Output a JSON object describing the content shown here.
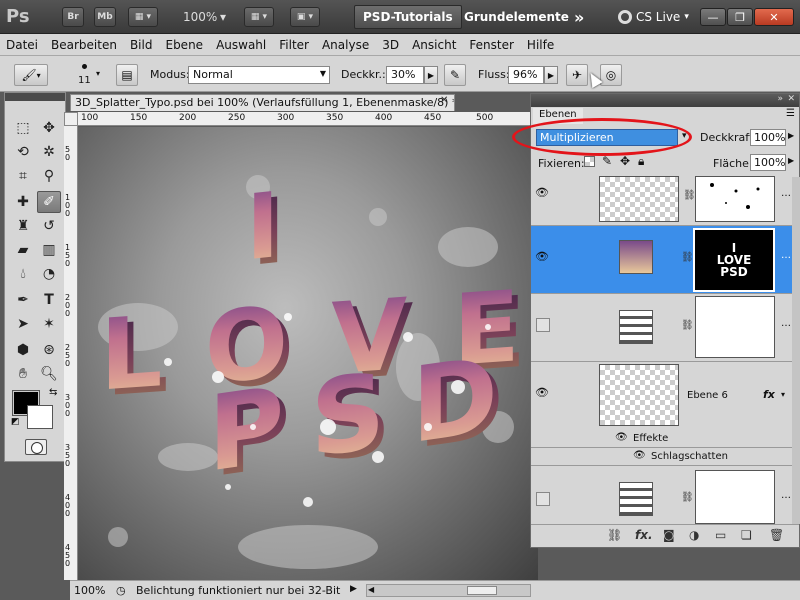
{
  "appbar": {
    "logo": "Ps",
    "btn_br": "Br",
    "btn_mb": "Mb",
    "zoom": "100%",
    "workspace_active": "PSD-Tutorials",
    "workspace_other": "Grundelemente",
    "more": "»",
    "cs_live": "CS Live",
    "win_min": "—",
    "win_restore": "❐",
    "win_close": "✕"
  },
  "menu": [
    "Datei",
    "Bearbeiten",
    "Bild",
    "Ebene",
    "Auswahl",
    "Filter",
    "Analyse",
    "3D",
    "Ansicht",
    "Fenster",
    "Hilfe"
  ],
  "options": {
    "brush_size": "11",
    "mode_label": "Modus:",
    "mode_value": "Normal",
    "opacity_label": "Deckkr.:",
    "opacity_value": "30%",
    "flow_label": "Fluss:",
    "flow_value": "96%"
  },
  "document": {
    "tab_title": "3D_Splatter_Typo.psd bei 100% (Verlaufsfüllung 1, Ebenenmaske/8) *",
    "close": "✕",
    "ruler_h": [
      "100",
      "150",
      "200",
      "250",
      "300",
      "350",
      "400",
      "450",
      "500"
    ],
    "ruler_v": [
      "5",
      "0",
      "1",
      "0",
      "0",
      "1",
      "5",
      "0",
      "2",
      "0",
      "0",
      "2",
      "5",
      "0",
      "3",
      "0",
      "0",
      "3",
      "5",
      "0",
      "4",
      "0",
      "0",
      "4",
      "5",
      "0"
    ],
    "artwork": {
      "line1": "I",
      "line2": "LOVE",
      "line3": "PSD"
    }
  },
  "status": {
    "zoom": "100%",
    "message": "Belichtung funktioniert nur bei 32-Bit"
  },
  "layers": {
    "tab": "Ebenen",
    "blend_mode": "Multiplizieren",
    "opacity_label": "Deckkraft:",
    "opacity_value": "100%",
    "lock_label": "Fixieren:",
    "fill_label": "Fläche:",
    "fill_value": "100%",
    "layer_ebene6": "Ebene 6",
    "fx": "fx",
    "effects_label": "Effekte",
    "drop_shadow": "Schlagschatten",
    "mask_text": "I LOVE PSD"
  },
  "colors": {
    "accent": "#3b8eea",
    "annotation": "#e3141a",
    "text_gradient_top": "#7a4a8a",
    "text_gradient_bottom": "#e8c89a"
  }
}
